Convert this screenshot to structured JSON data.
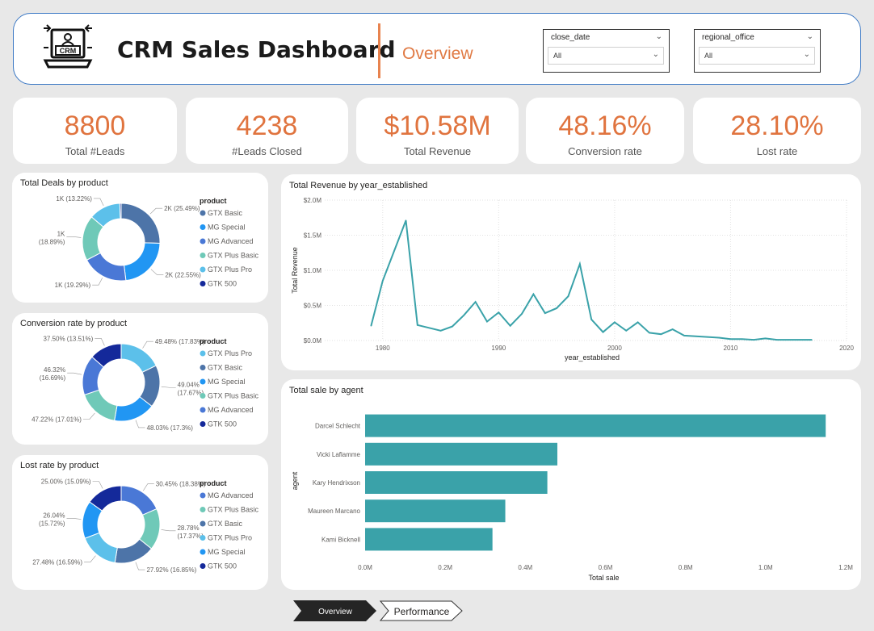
{
  "header": {
    "logo_text": "CRM",
    "title": "CRM Sales Dashboard",
    "subtitle": "Overview"
  },
  "filters": [
    {
      "title": "close_date",
      "value": "All"
    },
    {
      "title": "regional_office",
      "value": "All"
    }
  ],
  "kpis": [
    {
      "value": "8800",
      "label": "Total #Leads"
    },
    {
      "value": "4238",
      "label": "#Leads Closed"
    },
    {
      "value": "$10.58M",
      "label": "Total Revenue"
    },
    {
      "value": "48.16%",
      "label": "Conversion rate"
    },
    {
      "value": "28.10%",
      "label": "Lost rate"
    }
  ],
  "tabs": {
    "overview": "Overview",
    "performance": "Performance"
  },
  "colors": {
    "accent": "#e0743f",
    "teal": "#3aa2a9",
    "header_border": "#3b78c4"
  },
  "chart_data": [
    {
      "type": "pie",
      "title": "Total Deals by product",
      "legend_title": "product",
      "legend": [
        {
          "name": "GTX Basic",
          "color": "#4d74a8"
        },
        {
          "name": "MG Special",
          "color": "#2196f3"
        },
        {
          "name": "MG Advanced",
          "color": "#4a78d6"
        },
        {
          "name": "GTX Plus Basic",
          "color": "#6fc9b8"
        },
        {
          "name": "GTX Plus Pro",
          "color": "#5cc0ea"
        },
        {
          "name": "GTK 500",
          "color": "#14299a"
        }
      ],
      "slices": [
        {
          "name": "GTX Basic",
          "value": 25.49,
          "label": "2K (25.49%)",
          "color": "#4d74a8"
        },
        {
          "name": "MG Special",
          "value": 22.55,
          "label": "2K (22.55%)",
          "color": "#2196f3"
        },
        {
          "name": "MG Advanced",
          "value": 19.29,
          "label": "1K (19.29%)",
          "color": "#4a78d6"
        },
        {
          "name": "GTX Plus Basic",
          "value": 18.89,
          "label": "1K (18.89%)",
          "color": "#6fc9b8"
        },
        {
          "name": "GTX Plus Pro",
          "value": 13.22,
          "label": "1K (13.22%)",
          "color": "#5cc0ea"
        },
        {
          "name": "GTK 500",
          "value": 0.56,
          "label": "",
          "color": "#14299a"
        }
      ]
    },
    {
      "type": "pie",
      "title": "Conversion rate by product",
      "legend_title": "product",
      "legend": [
        {
          "name": "GTX Plus Pro",
          "color": "#5cc0ea"
        },
        {
          "name": "GTX Basic",
          "color": "#4d74a8"
        },
        {
          "name": "MG Special",
          "color": "#2196f3"
        },
        {
          "name": "GTX Plus Basic",
          "color": "#6fc9b8"
        },
        {
          "name": "MG Advanced",
          "color": "#4a78d6"
        },
        {
          "name": "GTK 500",
          "color": "#14299a"
        }
      ],
      "slices": [
        {
          "name": "GTX Plus Pro",
          "value": 17.83,
          "label": "49.48% (17.83%)",
          "color": "#5cc0ea"
        },
        {
          "name": "GTX Basic",
          "value": 17.67,
          "label": "49.04% (17.67%)",
          "color": "#4d74a8"
        },
        {
          "name": "MG Special",
          "value": 17.3,
          "label": "48.03% (17.3%)",
          "color": "#2196f3"
        },
        {
          "name": "GTX Plus Basic",
          "value": 17.01,
          "label": "47.22% (17.01%)",
          "color": "#6fc9b8"
        },
        {
          "name": "MG Advanced",
          "value": 16.69,
          "label": "46.32% (16.69%)",
          "color": "#4a78d6"
        },
        {
          "name": "GTK 500",
          "value": 13.51,
          "label": "37.50% (13.51%)",
          "color": "#14299a"
        }
      ]
    },
    {
      "type": "pie",
      "title": "Lost rate by product",
      "legend_title": "product",
      "legend": [
        {
          "name": "MG Advanced",
          "color": "#4a78d6"
        },
        {
          "name": "GTX Plus Basic",
          "color": "#6fc9b8"
        },
        {
          "name": "GTX Basic",
          "color": "#4d74a8"
        },
        {
          "name": "GTX Plus Pro",
          "color": "#5cc0ea"
        },
        {
          "name": "MG Special",
          "color": "#2196f3"
        },
        {
          "name": "GTK 500",
          "color": "#14299a"
        }
      ],
      "slices": [
        {
          "name": "MG Advanced",
          "value": 18.38,
          "label": "30.45% (18.38%)",
          "color": "#4a78d6"
        },
        {
          "name": "GTX Plus Basic",
          "value": 17.37,
          "label": "28.78% (17.37%)",
          "color": "#6fc9b8"
        },
        {
          "name": "GTX Basic",
          "value": 16.85,
          "label": "27.92% (16.85%)",
          "color": "#4d74a8"
        },
        {
          "name": "GTX Plus Pro",
          "value": 16.59,
          "label": "27.48% (16.59%)",
          "color": "#5cc0ea"
        },
        {
          "name": "MG Special",
          "value": 15.72,
          "label": "26.04% (15.72%)",
          "color": "#2196f3"
        },
        {
          "name": "GTK 500",
          "value": 15.09,
          "label": "25.00% (15.09%)",
          "color": "#14299a"
        }
      ]
    },
    {
      "type": "line",
      "title": "Total Revenue by year_established",
      "xlabel": "year_established",
      "ylabel": "Total Revenue",
      "xlim": [
        1975,
        2020
      ],
      "ylim": [
        0,
        2.0
      ],
      "x_ticks": [
        1980,
        1990,
        2000,
        2010,
        2020
      ],
      "y_ticks": [
        {
          "v": 0,
          "label": "$0.0M"
        },
        {
          "v": 0.5,
          "label": "$0.5M"
        },
        {
          "v": 1.0,
          "label": "$1.0M"
        },
        {
          "v": 1.5,
          "label": "$1.5M"
        },
        {
          "v": 2.0,
          "label": "$2.0M"
        }
      ],
      "grid": true,
      "color": "#3aa2a9",
      "x": [
        1979,
        1980,
        1981,
        1982,
        1983,
        1984,
        1985,
        1986,
        1987,
        1988,
        1989,
        1990,
        1991,
        1992,
        1993,
        1994,
        1995,
        1996,
        1997,
        1998,
        1999,
        2000,
        2001,
        2002,
        2003,
        2004,
        2005,
        2006,
        2007,
        2008,
        2009,
        2010,
        2011,
        2012,
        2013,
        2014,
        2015,
        2016,
        2017
      ],
      "y": [
        0.21,
        0.85,
        1.28,
        1.71,
        0.22,
        0.18,
        0.14,
        0.2,
        0.36,
        0.55,
        0.27,
        0.4,
        0.21,
        0.38,
        0.66,
        0.39,
        0.46,
        0.63,
        1.09,
        0.3,
        0.12,
        0.26,
        0.14,
        0.26,
        0.11,
        0.09,
        0.16,
        0.07,
        0.06,
        0.05,
        0.04,
        0.02,
        0.02,
        0.01,
        0.03,
        0.01,
        0.01,
        0.01,
        0.01
      ]
    },
    {
      "type": "bar",
      "orientation": "horizontal",
      "title": "Total sale by agent",
      "xlabel": "Total sale",
      "ylabel": "agent",
      "xlim": [
        0,
        1.2
      ],
      "x_ticks": [
        {
          "v": 0,
          "label": "0.0M"
        },
        {
          "v": 0.2,
          "label": "0.2M"
        },
        {
          "v": 0.4,
          "label": "0.4M"
        },
        {
          "v": 0.6,
          "label": "0.6M"
        },
        {
          "v": 0.8,
          "label": "0.8M"
        },
        {
          "v": 1.0,
          "label": "1.0M"
        },
        {
          "v": 1.2,
          "label": "1.2M"
        }
      ],
      "color": "#3aa2a9",
      "categories": [
        "Darcel Schlecht",
        "Vicki Laflamme",
        "Kary Hendrixson",
        "Maureen Marcano",
        "Kami Bicknell"
      ],
      "values": [
        1.15,
        0.48,
        0.455,
        0.35,
        0.318
      ]
    }
  ]
}
